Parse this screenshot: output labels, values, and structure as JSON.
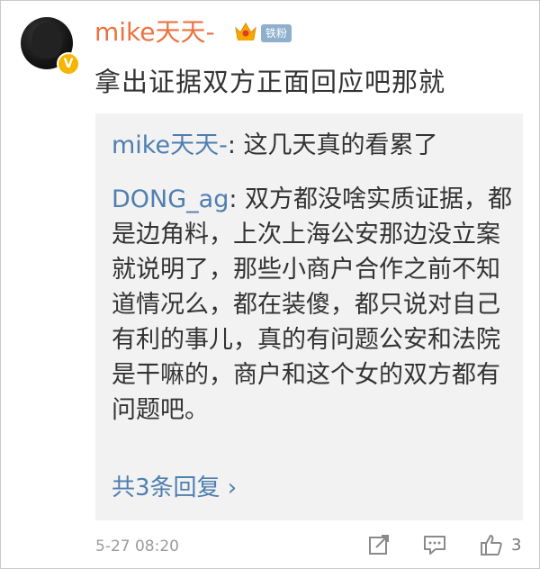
{
  "comment": {
    "username": "mike天天-",
    "fan_badge": "铁粉",
    "text": "拿出证据双方正面回应吧那就"
  },
  "replies": [
    {
      "author": "mike天天-",
      "separator": ": ",
      "text": "这几天真的看累了"
    },
    {
      "author": "DONG_ag",
      "separator": ": ",
      "text": "双方都没啥实质证据，都是边角料，上次上海公安那边没立案就说明了，那些小商户合作之前不知道情况么，都在装傻，都只说对自己有利的事儿，真的有问题公安和法院是干嘛的，商户和这个女的双方都有问题吧。"
    }
  ],
  "more_replies": "共3条回复 ›",
  "footer": {
    "timestamp": "5-27 08:20",
    "like_count": "3"
  },
  "icons": {
    "verified": "verified-v-icon",
    "crown": "crown-icon",
    "share": "share-icon",
    "comment": "comment-icon",
    "like": "thumbs-up-icon"
  },
  "colors": {
    "username": "#eb7340",
    "link": "#4f7eb0",
    "reply_bg": "#f2f2f2",
    "verified": "#f7b500"
  }
}
